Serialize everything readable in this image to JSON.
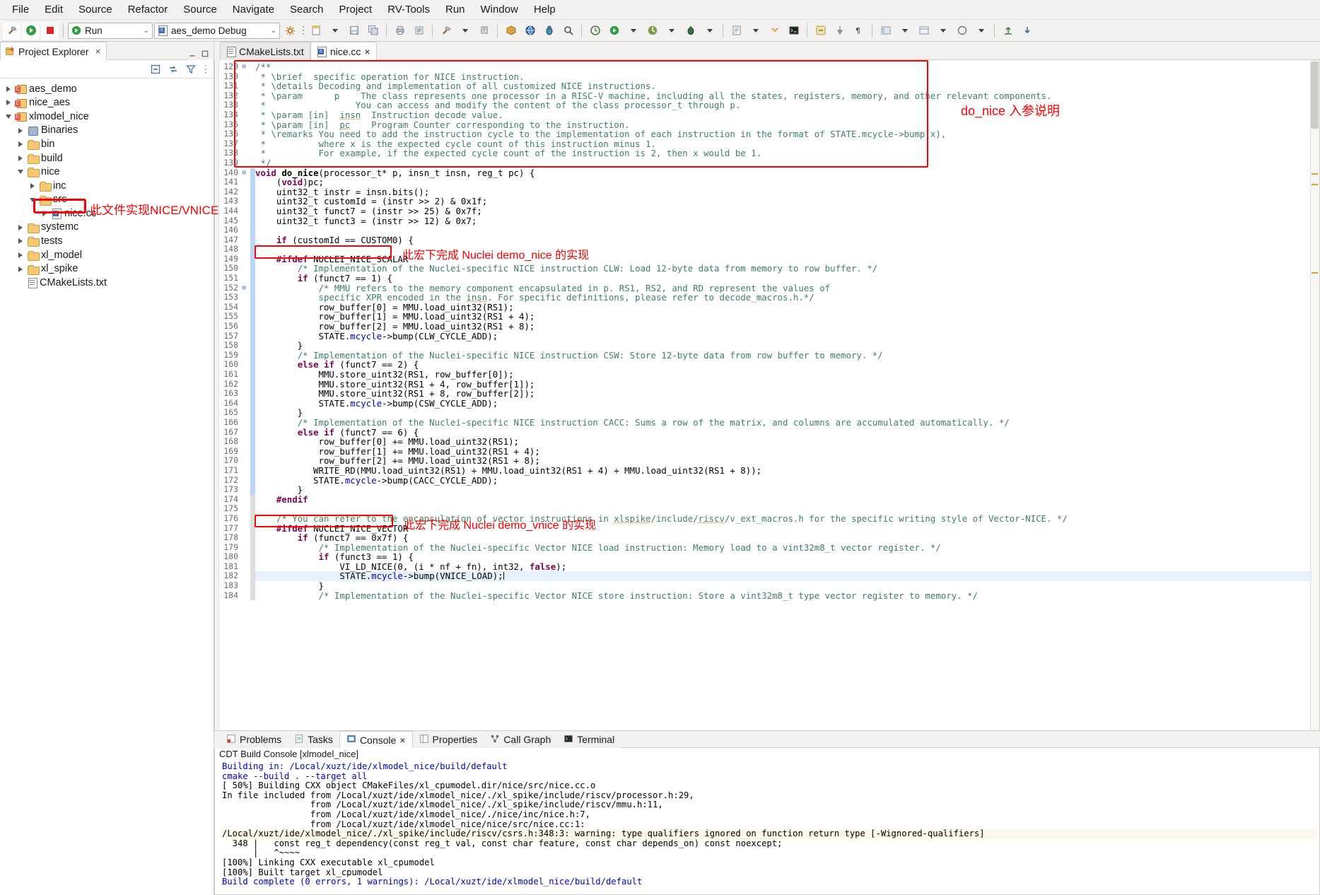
{
  "menubar": {
    "items": [
      "File",
      "Edit",
      "Source",
      "Refactor",
      "Source",
      "Navigate",
      "Search",
      "Project",
      "RV-Tools",
      "Run",
      "Window",
      "Help"
    ]
  },
  "toolbar": {
    "run_mode": "Run",
    "launch_config": "aes_demo Debug",
    "icons": [
      "build-hammer-icon",
      "run-icon",
      "stop-icon",
      "new-file-icon",
      "save-icon",
      "save-all-icon",
      "print-icon",
      "search-icon",
      "build-all-icon",
      "terminal-icon",
      "debug-icon",
      "perspective-icon"
    ]
  },
  "project_explorer": {
    "tab_label": "Project Explorer",
    "tab_close": "×",
    "toolbar_icons": [
      "collapse-all-icon",
      "link-with-editor-icon",
      "view-menu-filter-icon",
      "minimize-icon",
      "maximize-icon"
    ],
    "tree": [
      {
        "label": "aes_demo",
        "depth": 0,
        "icon": "project-icon",
        "twisty": "collapsed"
      },
      {
        "label": "nice_aes",
        "depth": 0,
        "icon": "project-icon",
        "twisty": "collapsed"
      },
      {
        "label": "xlmodel_nice",
        "depth": 0,
        "icon": "project-icon",
        "twisty": "expanded"
      },
      {
        "label": "Binaries",
        "depth": 1,
        "icon": "binaries-icon",
        "twisty": "collapsed"
      },
      {
        "label": "bin",
        "depth": 1,
        "icon": "folder-icon",
        "twisty": "collapsed"
      },
      {
        "label": "build",
        "depth": 1,
        "icon": "folder-icon",
        "twisty": "collapsed"
      },
      {
        "label": "nice",
        "depth": 1,
        "icon": "folder-icon",
        "twisty": "expanded"
      },
      {
        "label": "inc",
        "depth": 2,
        "icon": "folder-icon",
        "twisty": "collapsed"
      },
      {
        "label": "src",
        "depth": 2,
        "icon": "folder-icon",
        "twisty": "expanded"
      },
      {
        "label": "nice.cc",
        "depth": 3,
        "icon": "c-source-icon",
        "twisty": "collapsed",
        "highlighted": true
      },
      {
        "label": "systemc",
        "depth": 1,
        "icon": "folder-icon",
        "twisty": "collapsed"
      },
      {
        "label": "tests",
        "depth": 1,
        "icon": "folder-icon",
        "twisty": "collapsed"
      },
      {
        "label": "xl_model",
        "depth": 1,
        "icon": "folder-icon",
        "twisty": "collapsed"
      },
      {
        "label": "xl_spike",
        "depth": 1,
        "icon": "folder-icon",
        "twisty": "collapsed"
      },
      {
        "label": "CMakeLists.txt",
        "depth": 1,
        "icon": "text-file-icon",
        "twisty": "none"
      }
    ],
    "annotation": "此文件实现NICE/VNICE"
  },
  "editor": {
    "tabs": [
      {
        "label": "CMakeLists.txt",
        "icon": "text-file-icon",
        "active": false,
        "closeable": false
      },
      {
        "label": "nice.cc",
        "icon": "c-source-icon",
        "active": true,
        "closeable": true,
        "close": "×"
      }
    ],
    "annotations": [
      {
        "name": "do-nice-params-annotation",
        "text": "do_nice 入参说明"
      },
      {
        "name": "scalar-macro-annotation",
        "text": "此宏下完成 Nuclei demo_nice 的实现"
      },
      {
        "name": "vector-macro-annotation",
        "text": "此宏下完成 Nuclei demo_vnice 的实现"
      }
    ],
    "first_line_number": 129,
    "lines": [
      {
        "n": 129,
        "fold": "⊖",
        "html": "<span class='cmt'>/**</span>"
      },
      {
        "n": 130,
        "html": "<span class='cmt'> * \\brief  specific operation for NICE instruction.</span>"
      },
      {
        "n": 131,
        "html": "<span class='cmt'> * \\details Decoding and implementation of all customized NICE instructions.</span>"
      },
      {
        "n": 132,
        "html": "<span class='cmt'> * \\param      p    The class represents one processor in a RISC-V machine, including all the states, registers, memory, and other relevant components.</span>"
      },
      {
        "n": 133,
        "html": "<span class='cmt'> *                 You can access and modify the content of the class processor_t through p.</span>"
      },
      {
        "n": 134,
        "html": "<span class='cmt'> * \\param [in]  <span class='uw'>insn</span>  Instruction decode value.</span>"
      },
      {
        "n": 135,
        "html": "<span class='cmt'> * \\param [in]  <span class='uw'>pc</span>    Program Counter corresponding to the instruction.</span>"
      },
      {
        "n": 136,
        "html": "<span class='cmt'> * \\remarks You need to add the instruction cycle to the implementation of each instruction in the format of STATE.mcycle-&gt;bump(x),</span>"
      },
      {
        "n": 137,
        "html": "<span class='cmt'> *          where x is the expected cycle count of this instruction minus 1.</span>"
      },
      {
        "n": 138,
        "html": "<span class='cmt'> *          For example, if the expected cycle count of the instruction is 2, then x would be 1.</span>"
      },
      {
        "n": 139,
        "html": "<span class='cmt'> */</span>"
      },
      {
        "n": 140,
        "fold": "⊖",
        "chbar": "blue",
        "html": "<span class='kw'>void</span> <span class='fn'>do_nice</span>(processor_t* p, insn_t insn, reg_t pc) {"
      },
      {
        "n": 141,
        "chbar": "blue",
        "html": "    (<span class='kw'>void</span>)pc;"
      },
      {
        "n": 142,
        "chbar": "blue",
        "html": "    uint32_t instr = insn.bits();"
      },
      {
        "n": 143,
        "chbar": "blue",
        "html": "    uint32_t customId = (instr &gt;&gt; 2) &amp; 0x1f;"
      },
      {
        "n": 144,
        "chbar": "blue",
        "html": "    uint32_t funct7 = (instr &gt;&gt; 25) &amp; 0x7f;"
      },
      {
        "n": 145,
        "chbar": "blue",
        "html": "    uint32_t funct3 = (instr &gt;&gt; 12) &amp; 0x7;"
      },
      {
        "n": 146,
        "chbar": "blue",
        "html": ""
      },
      {
        "n": 147,
        "chbar": "blue",
        "html": "    <span class='kw'>if</span> (customId == CUSTOM0) {"
      },
      {
        "n": 148,
        "chbar": "blue",
        "html": ""
      },
      {
        "n": 149,
        "chbar": "blue",
        "html": "    <span class='pp'>#ifdef</span> NUCLEI_NICE_SCALAR"
      },
      {
        "n": 150,
        "chbar": "blue",
        "html": "        <span class='cmt'>/* Implementation of the Nuclei-specific NICE instruction CLW: Load 12-byte data from memory to row buffer. */</span>"
      },
      {
        "n": 151,
        "chbar": "blue",
        "html": "        <span class='kw'>if</span> (funct7 == 1) {"
      },
      {
        "n": 152,
        "fold": "⊖",
        "chbar": "blue",
        "html": "            <span class='cmt'>/* MMU refers to the memory component encapsulated in p. RS1, RS2, and RD represent the values of</span>"
      },
      {
        "n": 153,
        "chbar": "blue",
        "html": "            <span class='cmt'>specific XPR encoded in the <span class='uw'>insn</span>. For specific definitions, please refer to decode_macros.h.*/</span>"
      },
      {
        "n": 154,
        "chbar": "blue",
        "html": "            row_buffer[0] = MMU.load_uint32(RS1);"
      },
      {
        "n": 155,
        "chbar": "blue",
        "html": "            row_buffer[1] = MMU.load_uint32(RS1 + 4);"
      },
      {
        "n": 156,
        "chbar": "blue",
        "html": "            row_buffer[2] = MMU.load_uint32(RS1 + 8);"
      },
      {
        "n": 157,
        "chbar": "blue",
        "html": "            STATE.<span class='fld'>mcycle</span>-&gt;bump(CLW_CYCLE_ADD);"
      },
      {
        "n": 158,
        "chbar": "blue",
        "html": "        }"
      },
      {
        "n": 159,
        "chbar": "blue",
        "html": "        <span class='cmt'>/* Implementation of the Nuclei-specific NICE instruction CSW: Store 12-byte data from row buffer to memory. */</span>"
      },
      {
        "n": 160,
        "chbar": "blue",
        "html": "        <span class='kw'>else if</span> (funct7 == 2) {"
      },
      {
        "n": 161,
        "chbar": "blue",
        "html": "            MMU.store_uint32(RS1, row_buffer[0]);"
      },
      {
        "n": 162,
        "chbar": "blue",
        "html": "            MMU.store_uint32(RS1 + 4, row_buffer[1]);"
      },
      {
        "n": 163,
        "chbar": "blue",
        "html": "            MMU.store_uint32(RS1 + 8, row_buffer[2]);"
      },
      {
        "n": 164,
        "chbar": "blue",
        "html": "            STATE.<span class='fld'>mcycle</span>-&gt;bump(CSW_CYCLE_ADD);"
      },
      {
        "n": 165,
        "chbar": "blue",
        "html": "        }"
      },
      {
        "n": 166,
        "chbar": "blue",
        "html": "        <span class='cmt'>/* Implementation of the Nuclei-specific NICE instruction CACC: Sums a row of the matrix, and columns are accumulated automatically. */</span>"
      },
      {
        "n": 167,
        "chbar": "blue",
        "html": "        <span class='kw'>else if</span> (funct7 == 6) {"
      },
      {
        "n": 168,
        "chbar": "blue",
        "html": "            row_buffer[0] += MMU.load_uint32(RS1);"
      },
      {
        "n": 169,
        "chbar": "blue",
        "html": "            row_buffer[1] += MMU.load_uint32(RS1 + 4);"
      },
      {
        "n": 170,
        "chbar": "blue",
        "html": "            row_buffer[2] += MMU.load_uint32(RS1 + 8);"
      },
      {
        "n": 171,
        "chbar": "blue",
        "html": "           WRITE_RD(MMU.load_uint32(RS1) + MMU.load_uint32(RS1 + 4) + MMU.load_uint32(RS1 + 8));"
      },
      {
        "n": 172,
        "chbar": "blue",
        "html": "           STATE.<span class='fld'>mcycle</span>-&gt;bump(CACC_CYCLE_ADD);"
      },
      {
        "n": 173,
        "chbar": "blue",
        "html": "        }"
      },
      {
        "n": 174,
        "chbar": "grey",
        "html": "    <span class='pp'>#endif</span>"
      },
      {
        "n": 175,
        "chbar": "grey",
        "html": ""
      },
      {
        "n": 176,
        "chbar": "grey",
        "html": "    <span class='cmt'>/* You can refer to the encapsulation of vector instructions in <span class='uw'>xlspike</span>/include/<span class='uw'>riscv</span>/v_ext_macros.h for the specific writing style of Vector-NICE. */</span>"
      },
      {
        "n": 177,
        "chbar": "grey",
        "html": "    <span class='pp'>#ifdef</span> NUCLEI_NICE_VECTOR"
      },
      {
        "n": 178,
        "chbar": "grey",
        "html": "        <span class='kw'>if</span> (funct7 == 0x7f) {"
      },
      {
        "n": 179,
        "chbar": "grey",
        "html": "            <span class='cmt'>/* Implementation of the Nuclei-specific Vector NICE load instruction: Memory load to a vint32m8_t vector register. */</span>"
      },
      {
        "n": 180,
        "chbar": "grey",
        "html": "            <span class='kw'>if</span> (funct3 == 1) {"
      },
      {
        "n": 181,
        "chbar": "grey",
        "html": "                VI_LD_NICE(0, (i * nf + fn), int32, <span class='kw'>false</span>);"
      },
      {
        "n": 182,
        "chbar": "grey",
        "highlight": true,
        "html": "                STATE.<span class='fld'>mcycle</span>-&gt;bump(VNICE_LOAD);<span class='cursor'></span>"
      },
      {
        "n": 183,
        "chbar": "grey",
        "html": "            }"
      },
      {
        "n": 184,
        "chbar": "grey",
        "html": "            <span class='cmt'>/* Implementation of the Nuclei-specific Vector NICE store instruction: Store a vint32m8_t type vector register to memory. */</span>"
      }
    ]
  },
  "console": {
    "tabs": [
      {
        "label": "Problems",
        "icon": "problems-icon",
        "active": false
      },
      {
        "label": "Tasks",
        "icon": "tasks-icon",
        "active": false
      },
      {
        "label": "Console",
        "icon": "console-icon",
        "active": true,
        "close": "×"
      },
      {
        "label": "Properties",
        "icon": "properties-icon",
        "active": false
      },
      {
        "label": "Call Graph",
        "icon": "call-graph-icon",
        "active": false
      },
      {
        "label": "Terminal",
        "icon": "terminal-icon",
        "active": false
      }
    ],
    "title": "CDT Build Console [xlmodel_nice]",
    "lines": [
      {
        "style": "blue",
        "text": "Building in: /Local/xuzt/ide/xlmodel_nice/build/default"
      },
      {
        "style": "blue",
        "text": "cmake --build . --target all"
      },
      {
        "style": "plain",
        "text": "[ 50%] Building CXX object CMakeFiles/xl_cpumodel.dir/nice/src/nice.cc.o"
      },
      {
        "style": "plain",
        "text": "In file included from /Local/xuzt/ide/xlmodel_nice/./xl_spike/include/riscv/processor.h:29,"
      },
      {
        "style": "plain",
        "text": "                 from /Local/xuzt/ide/xlmodel_nice/./xl_spike/include/riscv/mmu.h:11,"
      },
      {
        "style": "plain",
        "text": "                 from /Local/xuzt/ide/xlmodel_nice/./nice/inc/nice.h:7,"
      },
      {
        "style": "plain",
        "text": "                 from /Local/xuzt/ide/xlmodel_nice/nice/src/nice.cc:1:"
      },
      {
        "style": "warn",
        "text": "/Local/xuzt/ide/xlmodel_nice/./xl_spike/include/riscv/csrs.h:348:3: warning: type qualifiers ignored on function return type [-Wignored-qualifiers]"
      },
      {
        "style": "plain",
        "text": "  348 |   const reg_t dependency(const reg_t val, const char feature, const char depends_on) const noexcept;"
      },
      {
        "style": "plain",
        "text": "      |   ^~~~~"
      },
      {
        "style": "plain",
        "text": "[100%] Linking CXX executable xl_cpumodel"
      },
      {
        "style": "plain",
        "text": "[100%] Built target xl_cpumodel"
      },
      {
        "style": "blue",
        "text": "Build complete (0 errors, 1 warnings): /Local/xuzt/ide/xlmodel_nice/build/default"
      }
    ]
  },
  "colors": {
    "annotation_red": "#f20000",
    "comment_green": "#3f7f5f",
    "keyword_purple": "#7f0055",
    "console_blue": "#0000c0"
  }
}
